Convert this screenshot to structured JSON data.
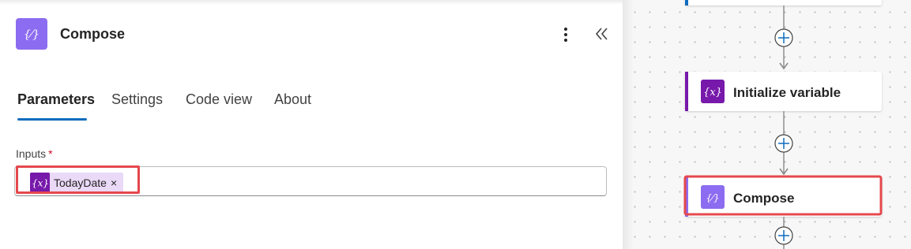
{
  "panel": {
    "title": "Compose",
    "header_icon": "expression-icon",
    "more_icon": "more-vertical-icon",
    "collapse_icon": "chevron-double-left-icon"
  },
  "tabs": [
    {
      "label": "Parameters",
      "active": true
    },
    {
      "label": "Settings",
      "active": false
    },
    {
      "label": "Code view",
      "active": false
    },
    {
      "label": "About",
      "active": false
    }
  ],
  "inputs": {
    "label": "Inputs",
    "required_marker": "*",
    "token": {
      "label": "TodayDate",
      "remove": "×",
      "icon": "variable-icon"
    }
  },
  "flow": {
    "nodes": [
      {
        "label": "",
        "icon": "",
        "accent": "#0f6cbd",
        "highlighted": false
      },
      {
        "label": "Initialize variable",
        "icon": "variable-icon",
        "accent": "#7719aa",
        "highlighted": false
      },
      {
        "label": "Compose",
        "icon": "expression-icon",
        "accent": "#8c6cf0",
        "highlighted": true
      }
    ],
    "add_step_icon": "plus-circle-icon"
  },
  "colors": {
    "accent": "#0f6cbd",
    "variable": "#7719aa",
    "compose": "#8c6cf0",
    "highlight": "#e5484d",
    "token_bg": "#ead9f7"
  }
}
